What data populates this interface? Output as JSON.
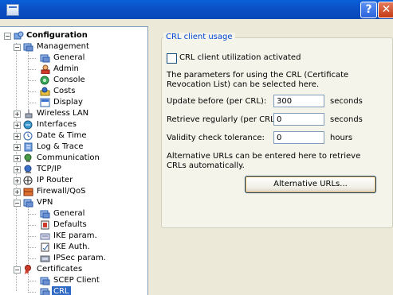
{
  "window": {
    "title": ""
  },
  "tree": {
    "items": [
      {
        "id": "configuration",
        "label": "Configuration",
        "bold": true
      },
      {
        "id": "management",
        "label": "Management"
      },
      {
        "id": "general",
        "label": "General"
      },
      {
        "id": "admin",
        "label": "Admin"
      },
      {
        "id": "console",
        "label": "Console"
      },
      {
        "id": "costs",
        "label": "Costs"
      },
      {
        "id": "display",
        "label": "Display"
      },
      {
        "id": "wireless-lan",
        "label": "Wireless LAN"
      },
      {
        "id": "interfaces",
        "label": "Interfaces"
      },
      {
        "id": "date-time",
        "label": "Date & Time"
      },
      {
        "id": "log-trace",
        "label": "Log & Trace"
      },
      {
        "id": "communication",
        "label": "Communication"
      },
      {
        "id": "tcp-ip",
        "label": "TCP/IP"
      },
      {
        "id": "ip-router",
        "label": "IP Router"
      },
      {
        "id": "firewall-qos",
        "label": "Firewall/QoS"
      },
      {
        "id": "vpn",
        "label": "VPN"
      },
      {
        "id": "vpn-general",
        "label": "General"
      },
      {
        "id": "defaults",
        "label": "Defaults"
      },
      {
        "id": "ike-param",
        "label": "IKE param."
      },
      {
        "id": "ike-auth",
        "label": "IKE Auth."
      },
      {
        "id": "ipsec-param",
        "label": "IPSec param."
      },
      {
        "id": "certificates",
        "label": "Certificates"
      },
      {
        "id": "scep-client",
        "label": "SCEP Client"
      },
      {
        "id": "crl",
        "label": "CRL",
        "selected": true
      }
    ]
  },
  "panel": {
    "group_title": "CRL client usage",
    "checkbox_label": "CRL client utilization activated",
    "checkbox_checked": false,
    "description": "The parameters for using the CRL (Certificate Revocation List) can be selected here.",
    "fields": [
      {
        "label": "Update before (per CRL):",
        "value": "300",
        "unit": "seconds"
      },
      {
        "label": "Retrieve regularly (per CRL):",
        "value": "0",
        "unit": "seconds"
      },
      {
        "label": "Validity check tolerance:",
        "value": "0",
        "unit": "hours"
      }
    ],
    "alt_text": "Alternative URLs can be entered here to retrieve CRLs automatically.",
    "alt_button": "Alternative URLs..."
  },
  "titlebar_buttons": {
    "help": "?",
    "close": "✕"
  }
}
